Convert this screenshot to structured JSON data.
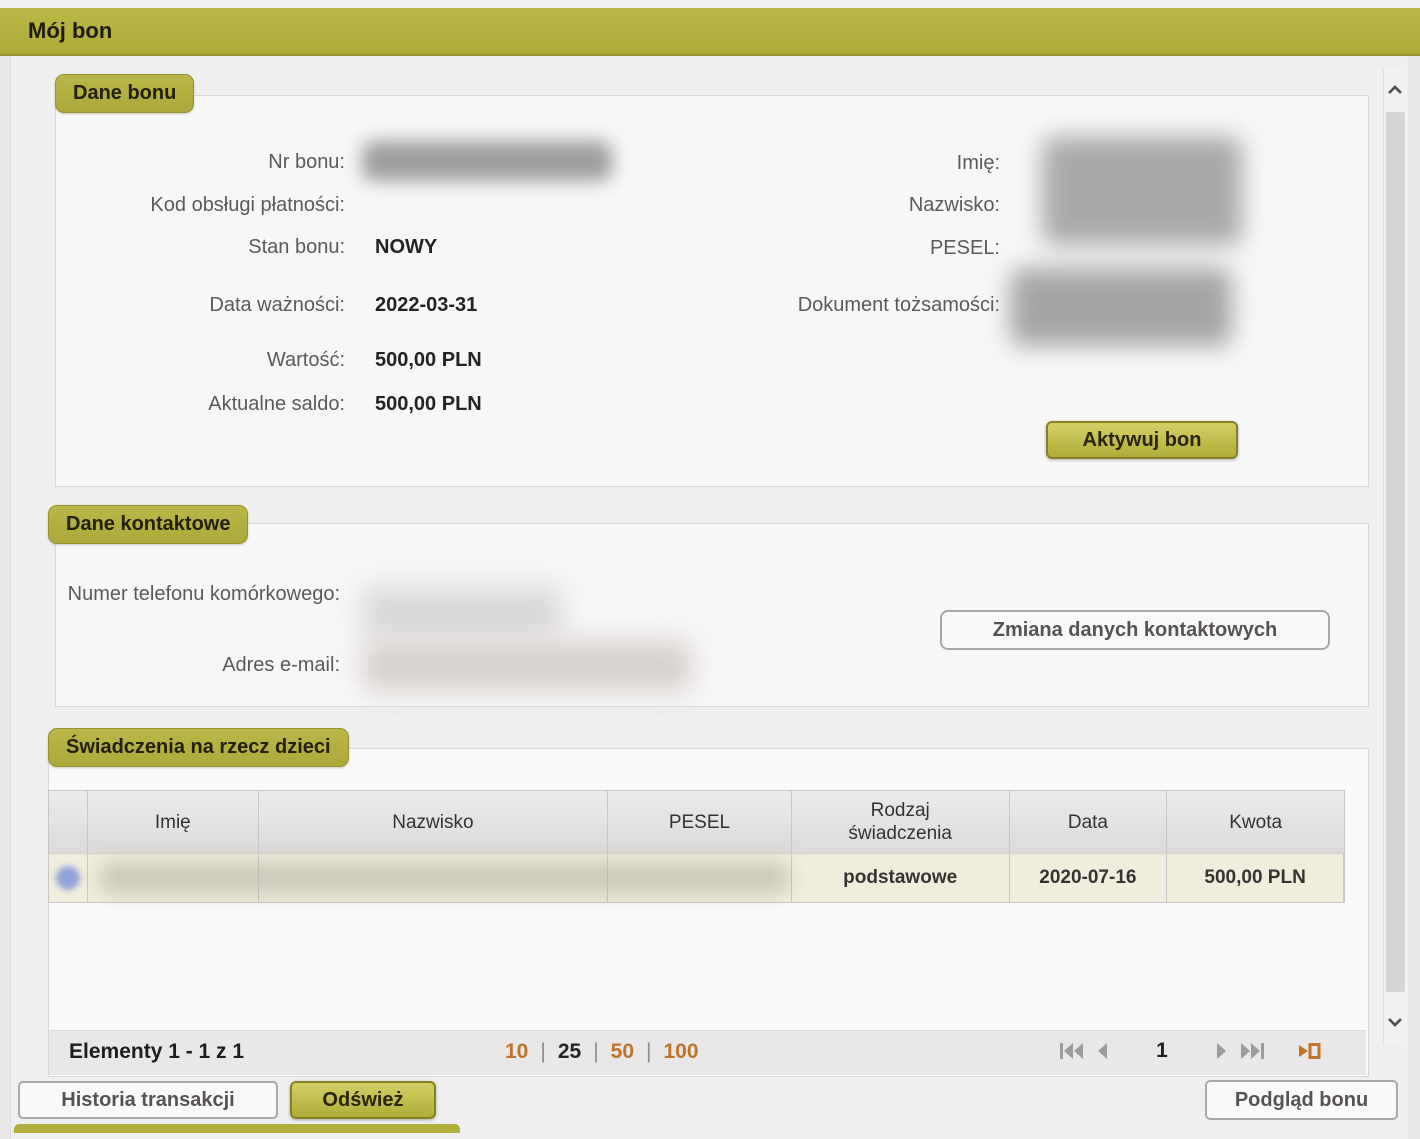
{
  "header": {
    "title": "Mój bon"
  },
  "sections": {
    "bon": {
      "title": "Dane bonu",
      "fields_left": [
        {
          "label": "Nr bonu:",
          "value": ""
        },
        {
          "label": "Kod obsługi płatności:",
          "value": ""
        },
        {
          "label": "Stan bonu:",
          "value": "NOWY"
        },
        {
          "label": "Data ważności:",
          "value": "2022-03-31"
        },
        {
          "label": "Wartość:",
          "value": "500,00 PLN"
        },
        {
          "label": "Aktualne saldo:",
          "value": "500,00 PLN"
        }
      ],
      "fields_right": [
        {
          "label": "Imię:"
        },
        {
          "label": "Nazwisko:"
        },
        {
          "label": "PESEL:"
        },
        {
          "label": "Dokument tożsamości:"
        }
      ],
      "activate_button_label": "Aktywuj bon"
    },
    "kontakt": {
      "title": "Dane kontaktowe",
      "phone_label": "Numer telefonu komórkowego:",
      "email_label": "Adres e-mail:",
      "change_button_label": "Zmiana danych kontaktowych"
    },
    "swiadczenia": {
      "title": "Świadczenia na rzecz dzieci",
      "table": {
        "columns": [
          "Imię",
          "Nazwisko",
          "PESEL",
          "Rodzaj świadczenia",
          "Data",
          "Kwota"
        ],
        "rows": [
          {
            "rodzaj_swiadczenia": "podstawowe",
            "data": "2020-07-16",
            "kwota": "500,00 PLN"
          }
        ]
      },
      "pagination": {
        "summary": "Elementy 1 - 1 z 1",
        "separator": "|",
        "page_sizes": [
          "10",
          "25",
          "50",
          "100"
        ],
        "active_page_size": "25",
        "current_page": "1"
      }
    }
  },
  "footer": {
    "history_button_label": "Historia transakcji",
    "refresh_button_label": "Odśwież",
    "preview_button_label": "Podgląd bonu"
  },
  "colors": {
    "accent_olive": "#b3af3e",
    "link_orange": "#c0732a",
    "row_highlight": "#efeddc",
    "status_new_value": "#252322"
  }
}
